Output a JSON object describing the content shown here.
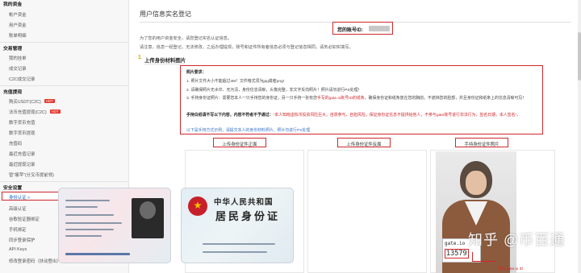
{
  "sidebar": {
    "section1": "我的资金",
    "account_funds": "帐户资金",
    "user_funds": "用户资金",
    "account_details": "账单明细",
    "section2": "交易管理",
    "my_orders": "我的挂单",
    "trade_history": "成交记录",
    "c2c_history": "C2C成交记录",
    "section3": "充值提现",
    "buy_usdt": "购买USDT(C2C)",
    "sell_usdt": "法币充值提现(C2C)",
    "crypto_deposit": "数字货币充值",
    "crypto_withdraw": "数字货币提现",
    "deposit_addr": "充值码",
    "recent_deposits": "最近充值记录",
    "recent_withdraws": "最近提现记录",
    "plane": "管\"痛苹\"(分叉币提前领)",
    "hot_badge": "HOT",
    "section4": "安全设置",
    "id_verification": "身份认证 >",
    "advanced_verification": "高级认证",
    "google_auth": "谷歌验证器绑定",
    "phone_bind": "手机绑定",
    "sync_login": "同步登录保护",
    "api_keys": "API Keys",
    "login_log": "修改登录密码（扶动登出）"
  },
  "main": {
    "title": "用户信息实名登记",
    "account_label": "您的账号ID:",
    "intro1": "为了您的用户资金安全，请您登记实名认证信息。",
    "intro2": "请注意，信息一经登记，无法修改，之后办理提现，账号和证件所有者信息必须与登记信息相同，请务必如实填写。",
    "section_num": "1",
    "section_title": "上传身份材料图片",
    "req_title": "照片要求：",
    "req1": "1. 照片文件大小不能超过4M！文件格式须为jpg或者png!",
    "req2": "2. 请确保照片无水印、无污渍，身份信息清晰，头像完整，非文字反向照片！照片请勿进行PS处理！",
    "req3_black": "3. 手持身份证照片：需要您本人一只手持您的身份证，另一只手持一张有您",
    "req3_red": "手写的gate.io账号ID的纸条",
    "req3_tail": "，确保身份证和纸条放在您的胸前，不遮挡您的脸部，并且身份证和纸条上的信息清晰可见！",
    "warn_black": "手持白纸请不写以下内容，内容不符者不予通过：",
    "warn_red": "\"本人知晓虚拟币投资风险巨大，自愿参与，自担风险，保证身份证信息不提供给他人，不参与gate账号进行非法行为，签名日期，本人签名\"。",
    "note_blue": "以下是手持方式示例，请提交本人的身份材料照片，照片勿进行PS处理",
    "cap_front": "上传身份证件正面",
    "cap_back": "上传身份证件反面",
    "cap_hold": "手持身份证件照片",
    "back_title1": "中华人民共和国",
    "back_title2": "居民身份证",
    "selfie_card_t1": "gate.io",
    "selfie_card_t2": "13579",
    "selfie_note": "您的 gate.io ID",
    "watermark": "知乎 @币百通"
  },
  "colors": {
    "accent_red": "#d0282d",
    "link_blue": "#1a66c2"
  }
}
